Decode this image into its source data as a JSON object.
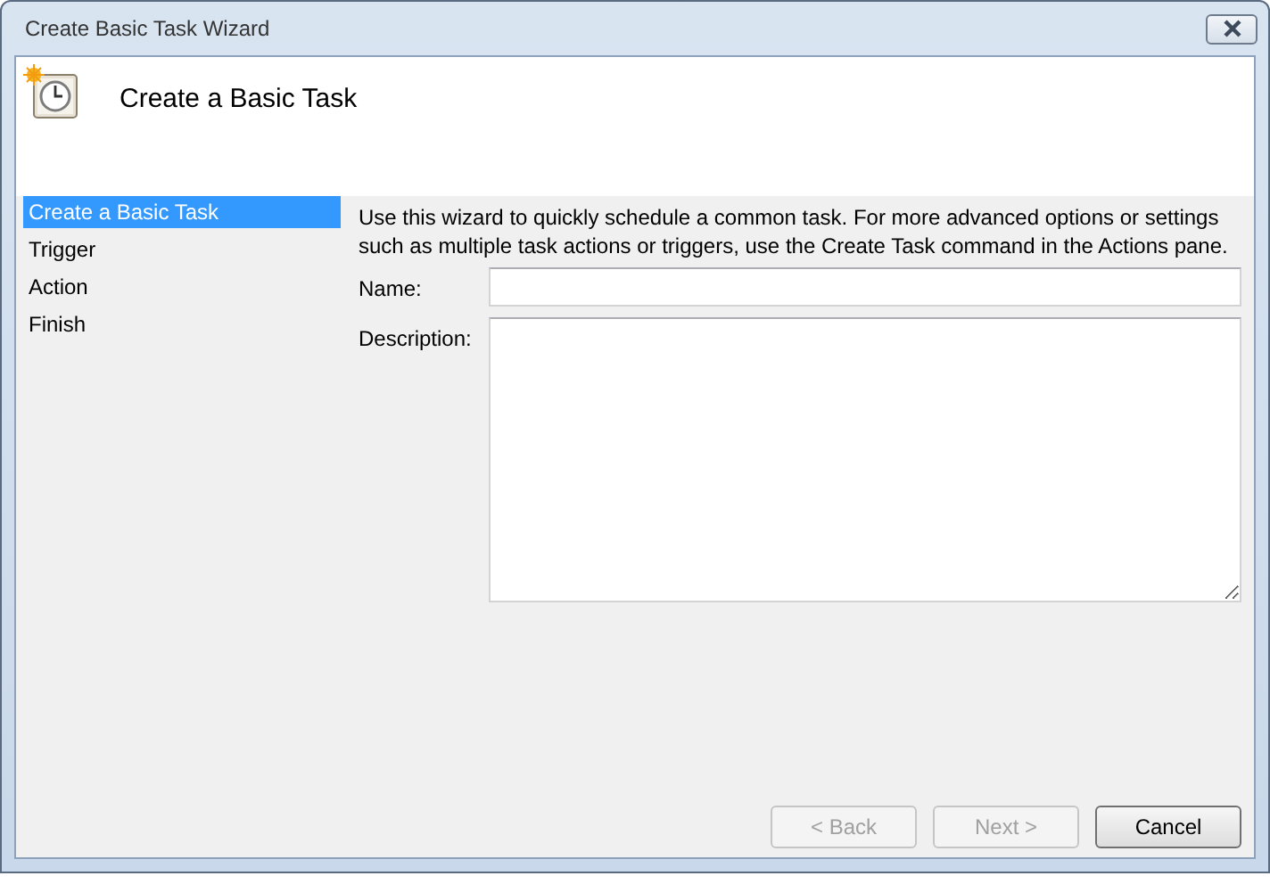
{
  "window": {
    "title": "Create Basic Task Wizard"
  },
  "header": {
    "title": "Create a Basic Task"
  },
  "steps": [
    {
      "label": "Create a Basic Task",
      "selected": true
    },
    {
      "label": "Trigger",
      "selected": false
    },
    {
      "label": "Action",
      "selected": false
    },
    {
      "label": "Finish",
      "selected": false
    }
  ],
  "intro": "Use this wizard to quickly schedule a common task.  For more advanced options or settings\nsuch as multiple task actions or triggers, use the Create Task command in the Actions pane.",
  "fields": [
    {
      "label": "Name:",
      "kind": "line"
    },
    {
      "label": "Description:",
      "kind": "area"
    }
  ],
  "buttons": [
    {
      "label": "< Back",
      "disabled": true
    },
    {
      "label": "Next >",
      "disabled": true
    },
    {
      "label": "Cancel",
      "disabled": false
    }
  ]
}
